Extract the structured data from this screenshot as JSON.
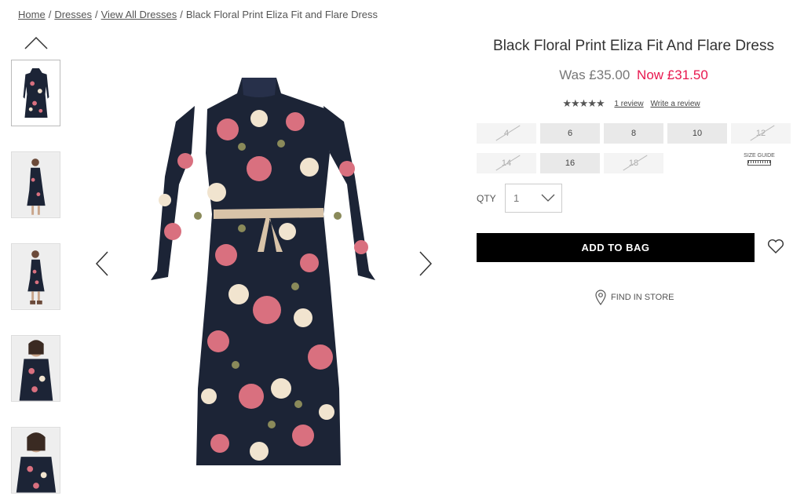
{
  "breadcrumb": {
    "items": [
      "Home",
      "Dresses",
      "View All Dresses"
    ],
    "current": "Black Floral Print Eliza Fit and Flare Dress",
    "separator": "/"
  },
  "product": {
    "title": "Black Floral Print Eliza Fit And Flare Dress",
    "price_was": "Was £35.00",
    "price_now": "Now £31.50",
    "rating_stars": 5,
    "review_link": "1 review",
    "write_review_link": "Write a review"
  },
  "sizes": [
    {
      "label": "4",
      "available": false
    },
    {
      "label": "6",
      "available": true
    },
    {
      "label": "8",
      "available": true
    },
    {
      "label": "10",
      "available": true
    },
    {
      "label": "12",
      "available": false
    },
    {
      "label": "14",
      "available": false
    },
    {
      "label": "16",
      "available": true
    },
    {
      "label": "18",
      "available": false
    }
  ],
  "size_guide": "SIZE GUIDE",
  "qty": {
    "label": "QTY",
    "value": "1"
  },
  "actions": {
    "add_to_bag": "ADD TO BAG",
    "find_in_store": "FIND IN STORE"
  },
  "colors": {
    "sale": "#e8174e",
    "button": "#000000",
    "dress_base": "#1c2436",
    "rose": "#d9707f",
    "cream": "#f1e4cf"
  },
  "icons": {
    "thumb_up": "chevron-up-icon",
    "prev": "chevron-left-icon",
    "next": "chevron-right-icon",
    "qty": "chevron-down-icon",
    "wishlist": "heart-icon",
    "store": "map-pin-icon"
  }
}
